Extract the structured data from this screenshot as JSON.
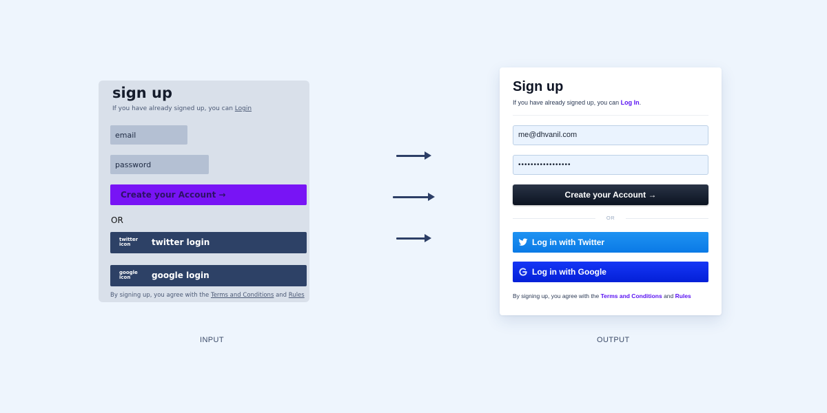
{
  "input": {
    "title": "sign up",
    "subtitle_prefix": "If you have already signed up, you can",
    "subtitle_link": "Login",
    "email_placeholder": "email",
    "password_placeholder": "password",
    "create_button": "Create your Account →",
    "or_text": "OR",
    "twitter_icon_text": "twitter icon",
    "twitter_label": "twitter login",
    "google_icon_text": "google icon",
    "google_label": "google login",
    "terms_prefix": "By signing up, you agree with the",
    "terms_link": "Terms and Conditions",
    "terms_and": "and",
    "rules_link": "Rules"
  },
  "output": {
    "title": "Sign up",
    "subtitle_prefix": "If you have already signed up, you can",
    "subtitle_link": "Log In",
    "subtitle_suffix": ".",
    "email_value": "me@dhvanil.com",
    "password_value": "•••••••••••••••••",
    "create_button": "Create your Account →",
    "or_text": "OR",
    "twitter_label": "Log in with Twitter",
    "google_label": "Log in with Google",
    "terms_prefix": "By signing up, you agree with the",
    "terms_link": "Terms and Conditions",
    "terms_and": "and",
    "rules_link": "Rules"
  },
  "captions": {
    "input": "INPUT",
    "output": "OUTPUT"
  },
  "colors": {
    "background": "#eef5fd",
    "input_accent": "#7814f5",
    "output_link": "#5a12f2",
    "twitter_blue": "#1e92f2",
    "google_blue": "#1536f5"
  }
}
